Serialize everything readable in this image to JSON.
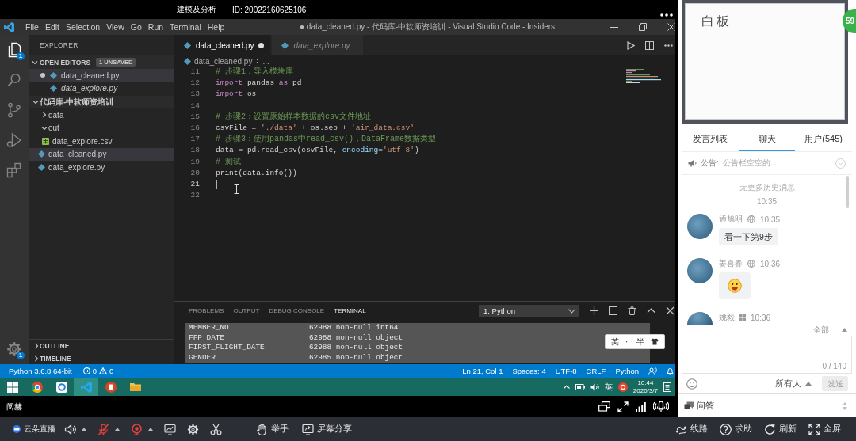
{
  "top_bar": {
    "title": "建模及分析",
    "id": "ID: 20022160625106"
  },
  "vscode": {
    "menu": [
      "File",
      "Edit",
      "Selection",
      "View",
      "Go",
      "Run",
      "Terminal",
      "Help"
    ],
    "title": "● data_cleaned.py - 代码库-中软师资培训 - Visual Studio Code - Insiders",
    "activity_bar": [
      {
        "kind": "explorer",
        "selected": true,
        "badge": "1"
      },
      {
        "kind": "search",
        "selected": false
      },
      {
        "kind": "source_control",
        "selected": false
      },
      {
        "kind": "run",
        "selected": false
      },
      {
        "kind": "extensions",
        "selected": false
      }
    ],
    "settings_badge": "1",
    "explorer": {
      "title": "EXPLORER",
      "open_editors": {
        "label": "OPEN EDITORS",
        "badge": "1 UNSAVED",
        "expanded": true,
        "items": [
          {
            "name": "data_cleaned.py",
            "unsaved": true,
            "preview": false,
            "selected": true
          },
          {
            "name": "data_explore.py",
            "unsaved": false,
            "preview": true,
            "selected": false
          }
        ]
      },
      "folder": {
        "label": "代码库-中软师资培训",
        "expanded": true,
        "children": [
          {
            "kind": "folder",
            "name": "data",
            "expanded": false,
            "selected": false
          },
          {
            "kind": "folder",
            "name": "out",
            "expanded": true,
            "selected": false,
            "children": [
              {
                "kind": "csv",
                "name": "data_explore.csv",
                "selected": false
              }
            ]
          },
          {
            "kind": "python",
            "name": "data_cleaned.py",
            "selected": true
          },
          {
            "kind": "python",
            "name": "data_explore.py",
            "selected": false
          }
        ]
      },
      "sections": [
        {
          "label": "OUTLINE",
          "expanded": false
        },
        {
          "label": "TIMELINE",
          "expanded": false
        }
      ]
    },
    "tabs": [
      {
        "label": "data_cleaned.py",
        "selected": true,
        "unsaved": true,
        "preview": false
      },
      {
        "label": "data_explore.py",
        "selected": false,
        "unsaved": false,
        "preview": true
      }
    ],
    "breadcrumb": [
      "data_cleaned.py",
      "..."
    ],
    "code": [
      {
        "number": "11",
        "cursor": false,
        "tokens": [
          {
            "kind": "comment",
            "text": "# 步骤1：导入模块库"
          }
        ]
      },
      {
        "number": "12",
        "cursor": false,
        "tokens": [
          {
            "kind": "keyword",
            "text": "import"
          },
          {
            "kind": "plain",
            "text": " pandas "
          },
          {
            "kind": "keyword",
            "text": "as"
          },
          {
            "kind": "plain",
            "text": " pd"
          }
        ]
      },
      {
        "number": "13",
        "cursor": false,
        "tokens": [
          {
            "kind": "keyword",
            "text": "import"
          },
          {
            "kind": "plain",
            "text": " os"
          }
        ]
      },
      {
        "number": "14",
        "cursor": false
      },
      {
        "number": "15",
        "cursor": false,
        "tokens": [
          {
            "kind": "comment",
            "text": "# 步骤2：设置原始样本数据的csv文件地址"
          }
        ]
      },
      {
        "number": "16",
        "cursor": false,
        "tokens": [
          {
            "kind": "plain",
            "text": "csvFile = "
          },
          {
            "kind": "string",
            "text": "'./data'"
          },
          {
            "kind": "plain",
            "text": " + os.sep + "
          },
          {
            "kind": "string",
            "text": "'air_data.csv'"
          }
        ]
      },
      {
        "number": "17",
        "cursor": false,
        "tokens": [
          {
            "kind": "comment",
            "text": "# 步骤3：使用pandas中read_csv()，DataFrame数据类型"
          }
        ]
      },
      {
        "number": "18",
        "cursor": false,
        "tokens": [
          {
            "kind": "plain",
            "text": "data = pd.read_csv(csvFile, "
          },
          {
            "kind": "param",
            "text": "encoding"
          },
          {
            "kind": "plain",
            "text": "="
          },
          {
            "kind": "string",
            "text": "'utf-8'"
          },
          {
            "kind": "plain",
            "text": ")"
          }
        ]
      },
      {
        "number": "19",
        "cursor": false,
        "tokens": [
          {
            "kind": "comment",
            "text": "# 测试"
          }
        ]
      },
      {
        "number": "20",
        "cursor": false,
        "tokens": [
          {
            "kind": "plain",
            "text": "print(data.info())"
          }
        ]
      },
      {
        "number": "21",
        "cursor": true
      },
      {
        "number": "22",
        "cursor": false
      }
    ],
    "panel": {
      "tabs": [
        {
          "label": "PROBLEMS",
          "selected": false
        },
        {
          "label": "OUTPUT",
          "selected": false
        },
        {
          "label": "DEBUG CONSOLE",
          "selected": false
        },
        {
          "label": "TERMINAL",
          "selected": true
        }
      ],
      "terminal": "1: Python",
      "lines": [
        {
          "text": "MEMBER_NO                  62988 non-null int64",
          "selected": true
        },
        {
          "text": "FFP_DATE                   62988 non-null object",
          "selected": true
        },
        {
          "text": "FIRST_FLIGHT_DATE          62988 non-null object",
          "selected": true
        },
        {
          "text": "GENDER                     62985 non-null object",
          "selected": true
        }
      ]
    },
    "ime": [
      "英",
      "·,",
      "半"
    ],
    "status_bar": {
      "interpreter": "Python 3.6.8 64-bit",
      "errors": "0",
      "warnings": "0",
      "items": [
        "Ln 21, Col 1",
        "Spaces: 4",
        "UTF-8",
        "CRLF",
        "Python"
      ]
    },
    "taskbar": {
      "apps": [
        {
          "kind": "start",
          "selected": false
        },
        {
          "kind": "browser",
          "selected": false
        },
        {
          "kind": "circle",
          "selected": false
        },
        {
          "kind": "editor",
          "selected": true
        },
        {
          "kind": "presentation",
          "selected": false
        },
        {
          "kind": "folder",
          "selected": false
        }
      ],
      "ime": "英",
      "time": "10:44",
      "date": "2020/3/7"
    }
  },
  "video_footer": {
    "name": "阅赫"
  },
  "side_panel": {
    "whiteboard": {
      "title": "白板",
      "badge": "59"
    },
    "tabs": [
      {
        "label": "发言列表",
        "selected": false
      },
      {
        "label": "聊天",
        "selected": true
      },
      {
        "label": "用户(545)",
        "selected": false
      }
    ],
    "notice": {
      "label": "公告:",
      "text": "公告栏空空的..."
    },
    "history_note": "无更多历史消息",
    "history_time": "10:35",
    "messages": [
      {
        "name": "通旭明",
        "client": {
          "kind": "browser"
        },
        "time": "10:35",
        "kind": "text",
        "text": "看一下第9步"
      },
      {
        "name": "姜喜春",
        "client": {
          "kind": "browser"
        },
        "time": "10:36",
        "kind": "emoji"
      },
      {
        "name": "姚毅",
        "client": {
          "kind": "desktop"
        },
        "time": "10:36"
      }
    ],
    "filter": "全部",
    "input": {
      "counter": "0 / 140"
    },
    "recipient": "所有人",
    "send": {
      "label": "发送",
      "disabled": true
    },
    "qa": {
      "label": "问答"
    }
  },
  "toolbar": {
    "brand": "云朵直播",
    "controls": [
      {
        "kind": "speaker",
        "muted": false,
        "menu": true
      },
      {
        "kind": "microphone",
        "muted": true,
        "menu": true
      },
      {
        "kind": "camera",
        "muted": true,
        "menu": true
      },
      {
        "kind": "screen",
        "muted": false,
        "menu": false
      },
      {
        "kind": "settings",
        "muted": false,
        "menu": false
      },
      {
        "kind": "scissors",
        "muted": false,
        "menu": false
      }
    ],
    "actions": [
      {
        "kind": "raise_hand",
        "label": "举手"
      },
      {
        "kind": "share_screen",
        "label": "屏幕分享"
      }
    ],
    "right": [
      {
        "kind": "route",
        "label": "线路"
      },
      {
        "kind": "help",
        "label": "求助"
      },
      {
        "kind": "refresh",
        "label": "刷新"
      },
      {
        "kind": "fullscreen",
        "label": "全屏"
      }
    ]
  }
}
